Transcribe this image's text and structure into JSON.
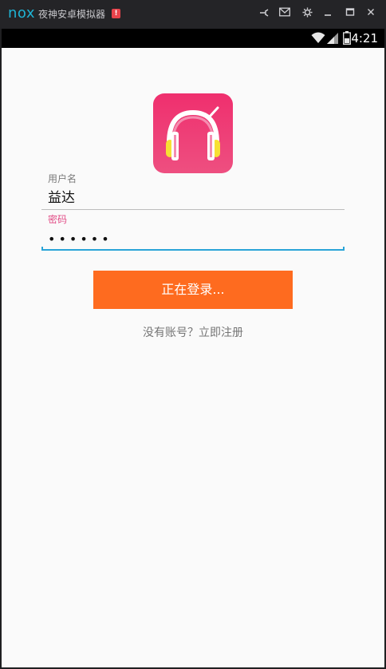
{
  "emulator": {
    "logo": "nox",
    "title": "夜神安卓模拟器",
    "alert": "!",
    "buttons": {
      "pin": "pin-icon",
      "mail": "mail-icon",
      "settings": "gear-icon",
      "minimize": "minimize-icon",
      "maximize": "maximize-icon",
      "close": "close-icon"
    }
  },
  "status_bar": {
    "time": "4:21",
    "icons": [
      "wifi-icon",
      "signal-icon",
      "battery-icon"
    ]
  },
  "login": {
    "app_icon": "headphones-icon",
    "username_label": "用户名",
    "username_value": "益达",
    "password_label": "密码",
    "password_value": "••••••",
    "login_button": "正在登录...",
    "register_link": "没有账号？立即注册"
  },
  "colors": {
    "accent_pink": "#ee3a74",
    "button_orange": "#fe6b1f",
    "focus_blue": "#2aa4d8",
    "password_label": "#e24c86"
  }
}
